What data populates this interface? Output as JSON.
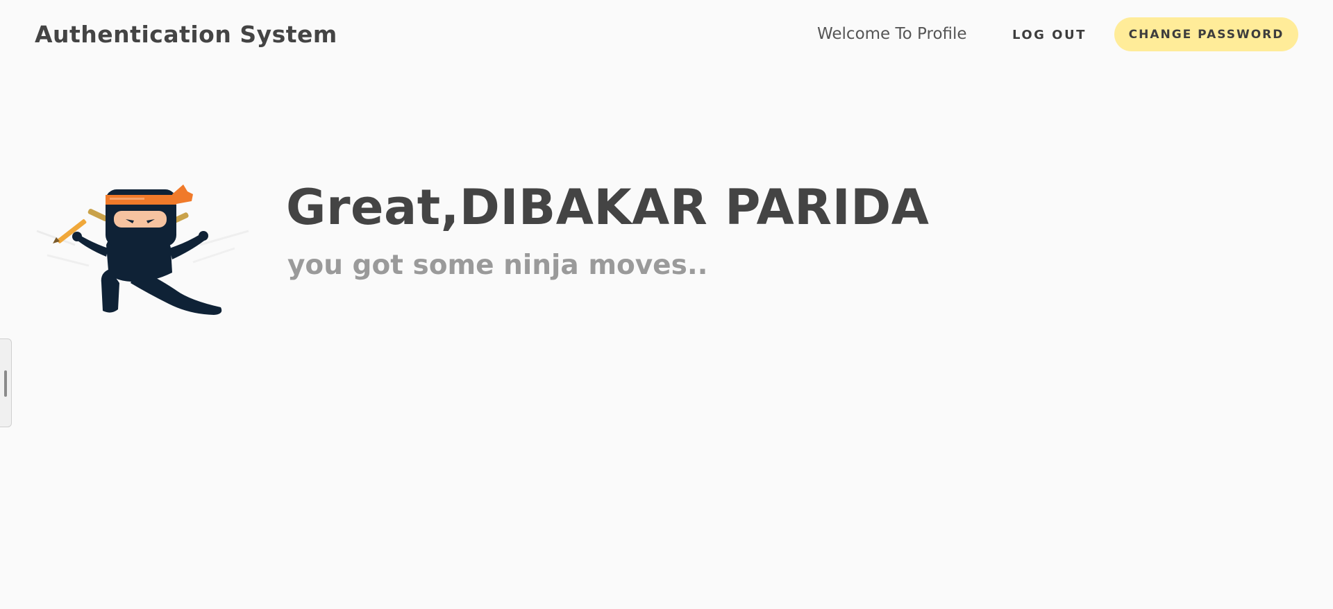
{
  "navbar": {
    "brand": "Authentication System",
    "welcome_link": "Welcome To Profile",
    "logout_label": "LOG OUT",
    "change_password_label": "CHANGE PASSWORD"
  },
  "hero": {
    "title": "Great,DIBAKAR PARIDA",
    "subtitle": "you got some ninja moves.."
  },
  "colors": {
    "background": "#fafafa",
    "text": "#444444",
    "subtitle": "#9a9a9a",
    "accent_button": "#ffec99",
    "ninja_body": "#0f2236",
    "ninja_headband": "#f07a2a"
  },
  "icons": {
    "hero_illustration": "ninja-illustration",
    "side_handle": "drag-handle-icon"
  }
}
